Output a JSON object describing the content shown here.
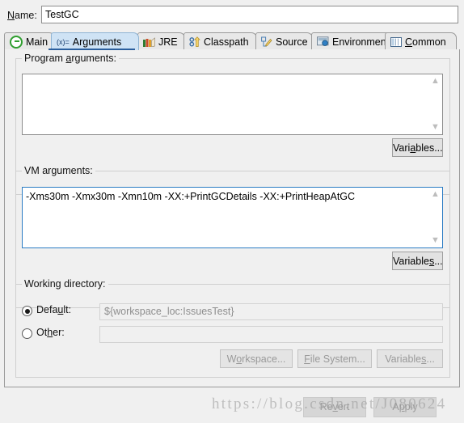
{
  "dialog": {
    "name_label": "Name:",
    "name_label_mnemonic": "N",
    "name_value": "TestGC"
  },
  "tabs": [
    {
      "label": "Main",
      "mnemonic": "M",
      "icon": "main-run-icon",
      "selected": false
    },
    {
      "label": "Arguments",
      "mnemonic": "",
      "icon": "arguments-variable-icon",
      "selected": true
    },
    {
      "label": "JRE",
      "mnemonic": "",
      "icon": "jre-books-icon",
      "selected": false
    },
    {
      "label": "Classpath",
      "mnemonic": "",
      "icon": "classpath-icon",
      "selected": false
    },
    {
      "label": "Source",
      "mnemonic": "",
      "icon": "source-pencil-icon",
      "selected": false
    },
    {
      "label": "Environment",
      "mnemonic": "",
      "icon": "environment-icon",
      "selected": false
    },
    {
      "label": "Common",
      "mnemonic": "C",
      "icon": "common-table-icon",
      "selected": false
    }
  ],
  "program_arguments": {
    "group_title": "Program arguments:",
    "value": "",
    "variables_button": "Variables...",
    "scroll_up_icon": "chevron-up-icon",
    "scroll_down_icon": "chevron-down-icon"
  },
  "vm_arguments": {
    "group_title": "VM arguments:",
    "value": "-Xms30m -Xmx30m -Xmn10m -XX:+PrintGCDetails -XX:+PrintHeapAtGC",
    "variables_button": "Variables...",
    "scroll_up_icon": "chevron-up-icon",
    "scroll_down_icon": "chevron-down-icon"
  },
  "working_directory": {
    "group_title": "Working directory:",
    "default_label": "Default:",
    "default_selected": true,
    "default_value": "${workspace_loc:IssuesTest}",
    "other_label": "Other:",
    "other_selected": false,
    "other_value": "",
    "workspace_button": "Workspace...",
    "file_system_button": "File System...",
    "variables_button": "Variables..."
  },
  "footer": {
    "revert_button": "Revert",
    "apply_button": "Apply"
  },
  "watermark": {
    "text": "https://blog.csdn.net/J080624"
  },
  "colors": {
    "dialog_bg": "#f0f0f0",
    "selected_tab_bg": "#cfe3f5",
    "selected_tab_underline": "#2b5f9e",
    "focus_border": "#2b7cc4",
    "field_border": "#8d8d8d"
  }
}
